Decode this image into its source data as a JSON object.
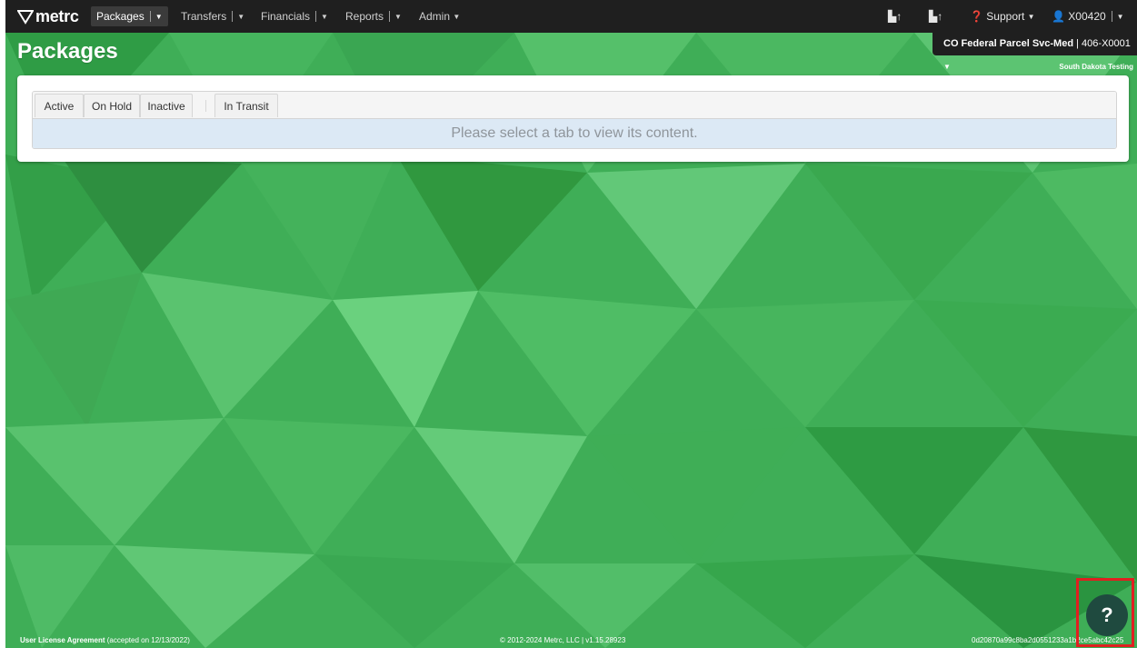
{
  "nav": {
    "logo_text": "metrc",
    "items": [
      {
        "label": "Packages"
      },
      {
        "label": "Transfers"
      },
      {
        "label": "Financials"
      },
      {
        "label": "Reports"
      },
      {
        "label": "Admin"
      }
    ],
    "support_label": "Support",
    "user_label": "X00420"
  },
  "facility": {
    "name": "CO Federal Parcel Svc-Med",
    "license": "406-X0001",
    "environment": "South Dakota Testing"
  },
  "page": {
    "title": "Packages"
  },
  "tabs": [
    {
      "label": "Active"
    },
    {
      "label": "On Hold"
    },
    {
      "label": "Inactive"
    },
    {
      "label": "In Transit"
    }
  ],
  "tab_placeholder": "Please select a tab to view its content.",
  "footer": {
    "license_link": "User License Agreement",
    "license_note": "(accepted on 12/13/2022)",
    "copyright": "© 2012-2024 Metrc, LLC  | v1.15.28923",
    "build_hash": "0d20870a99c8ba2d0551233a1b2ce5abc42c25"
  },
  "help": {
    "label": "?"
  },
  "colors": {
    "navbar": "#1f1f1f",
    "background_green": "#3fae57",
    "placeholder_bg": "#dce9f5",
    "help_button": "#1f4a3f",
    "highlight": "#e02020"
  }
}
